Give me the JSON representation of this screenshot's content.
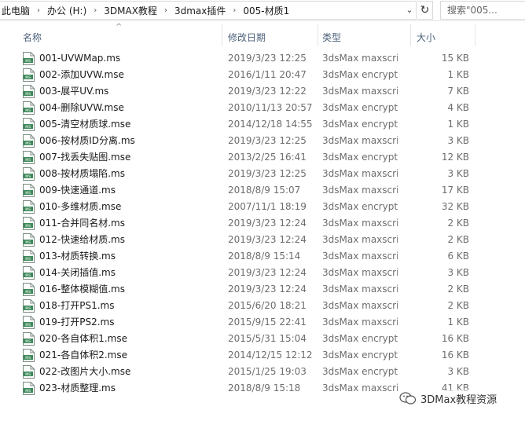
{
  "address": {
    "crumbs": [
      "此电脑",
      "办公 (H:)",
      "3DMAX教程",
      "3dmax插件",
      "005-材质1"
    ],
    "separator": "›",
    "dropdown": "⌄",
    "refresh": "↻"
  },
  "search": {
    "placeholder": "搜索\"005..."
  },
  "columns": {
    "name": "名称",
    "date": "修改日期",
    "type": "类型",
    "size": "大小",
    "sort_indicator": "^"
  },
  "files": [
    {
      "name": "001-UVWMap.ms",
      "date": "2019/3/23 12:25",
      "type": "3dsMax maxscri...",
      "size": "15 KB",
      "icon": "ms-file-icon"
    },
    {
      "name": "002-添加UVW.mse",
      "date": "2016/1/11 20:47",
      "type": "3dsMax encrypt...",
      "size": "1 KB",
      "icon": "mse-file-icon"
    },
    {
      "name": "003-展平UV.ms",
      "date": "2019/3/23 12:22",
      "type": "3dsMax maxscri...",
      "size": "7 KB",
      "icon": "ms-file-icon"
    },
    {
      "name": "004-删除UVW.mse",
      "date": "2010/11/13 20:57",
      "type": "3dsMax encrypt...",
      "size": "4 KB",
      "icon": "mse-file-icon"
    },
    {
      "name": "005-清空材质球.mse",
      "date": "2014/12/18 14:55",
      "type": "3dsMax encrypt...",
      "size": "1 KB",
      "icon": "mse-file-icon"
    },
    {
      "name": "006-按材质ID分离.ms",
      "date": "2019/3/23 12:25",
      "type": "3dsMax maxscri...",
      "size": "3 KB",
      "icon": "ms-file-icon"
    },
    {
      "name": "007-找丢失贴图.mse",
      "date": "2013/2/25 16:41",
      "type": "3dsMax encrypt...",
      "size": "12 KB",
      "icon": "mse-file-icon"
    },
    {
      "name": "008-按材质塌陷.ms",
      "date": "2019/3/23 12:25",
      "type": "3dsMax maxscri...",
      "size": "3 KB",
      "icon": "ms-file-icon"
    },
    {
      "name": "009-快速通道.ms",
      "date": "2018/8/9 15:07",
      "type": "3dsMax maxscri...",
      "size": "17 KB",
      "icon": "ms-file-icon"
    },
    {
      "name": "010-多维材质.mse",
      "date": "2007/11/1 18:19",
      "type": "3dsMax encrypt...",
      "size": "32 KB",
      "icon": "mse-file-icon"
    },
    {
      "name": "011-合并同名材.ms",
      "date": "2019/3/23 12:24",
      "type": "3dsMax maxscri...",
      "size": "2 KB",
      "icon": "ms-file-icon"
    },
    {
      "name": "012-快速给材质.ms",
      "date": "2019/3/23 12:24",
      "type": "3dsMax maxscri...",
      "size": "2 KB",
      "icon": "ms-file-icon"
    },
    {
      "name": "013-材质转换.ms",
      "date": "2018/8/9 15:14",
      "type": "3dsMax maxscri...",
      "size": "6 KB",
      "icon": "ms-file-icon"
    },
    {
      "name": "014-关闭插值.ms",
      "date": "2019/3/23 12:24",
      "type": "3dsMax maxscri...",
      "size": "3 KB",
      "icon": "ms-file-icon"
    },
    {
      "name": "016-整体模糊值.ms",
      "date": "2019/3/23 12:24",
      "type": "3dsMax maxscri...",
      "size": "2 KB",
      "icon": "ms-file-icon"
    },
    {
      "name": "018-打开PS1.ms",
      "date": "2015/6/20 18:21",
      "type": "3dsMax maxscri...",
      "size": "2 KB",
      "icon": "ms-file-icon"
    },
    {
      "name": "019-打开PS2.ms",
      "date": "2015/9/15 22:41",
      "type": "3dsMax maxscri...",
      "size": "1 KB",
      "icon": "ms-file-icon"
    },
    {
      "name": "020-各自体积1.mse",
      "date": "2015/5/31 15:04",
      "type": "3dsMax encrypt...",
      "size": "16 KB",
      "icon": "mse-file-icon"
    },
    {
      "name": "021-各自体积2.mse",
      "date": "2014/12/15 12:12",
      "type": "3dsMax encrypt...",
      "size": "16 KB",
      "icon": "mse-file-icon"
    },
    {
      "name": "022-改图片大小.mse",
      "date": "2015/1/25 19:03",
      "type": "3dsMax encrypt...",
      "size": "3 KB",
      "icon": "mse-file-icon"
    },
    {
      "name": "023-材质整理.ms",
      "date": "2018/8/9 15:18",
      "type": "3dsMax maxscri...",
      "size": "41 KB",
      "icon": "ms-file-icon"
    }
  ],
  "watermark": {
    "text": "3DMax教程资源"
  },
  "colors": {
    "header_text": "#4c607a",
    "detail_text": "#6d6d6d",
    "file_icon_green": "#3e8a5b",
    "border": "#d9d9d9"
  }
}
